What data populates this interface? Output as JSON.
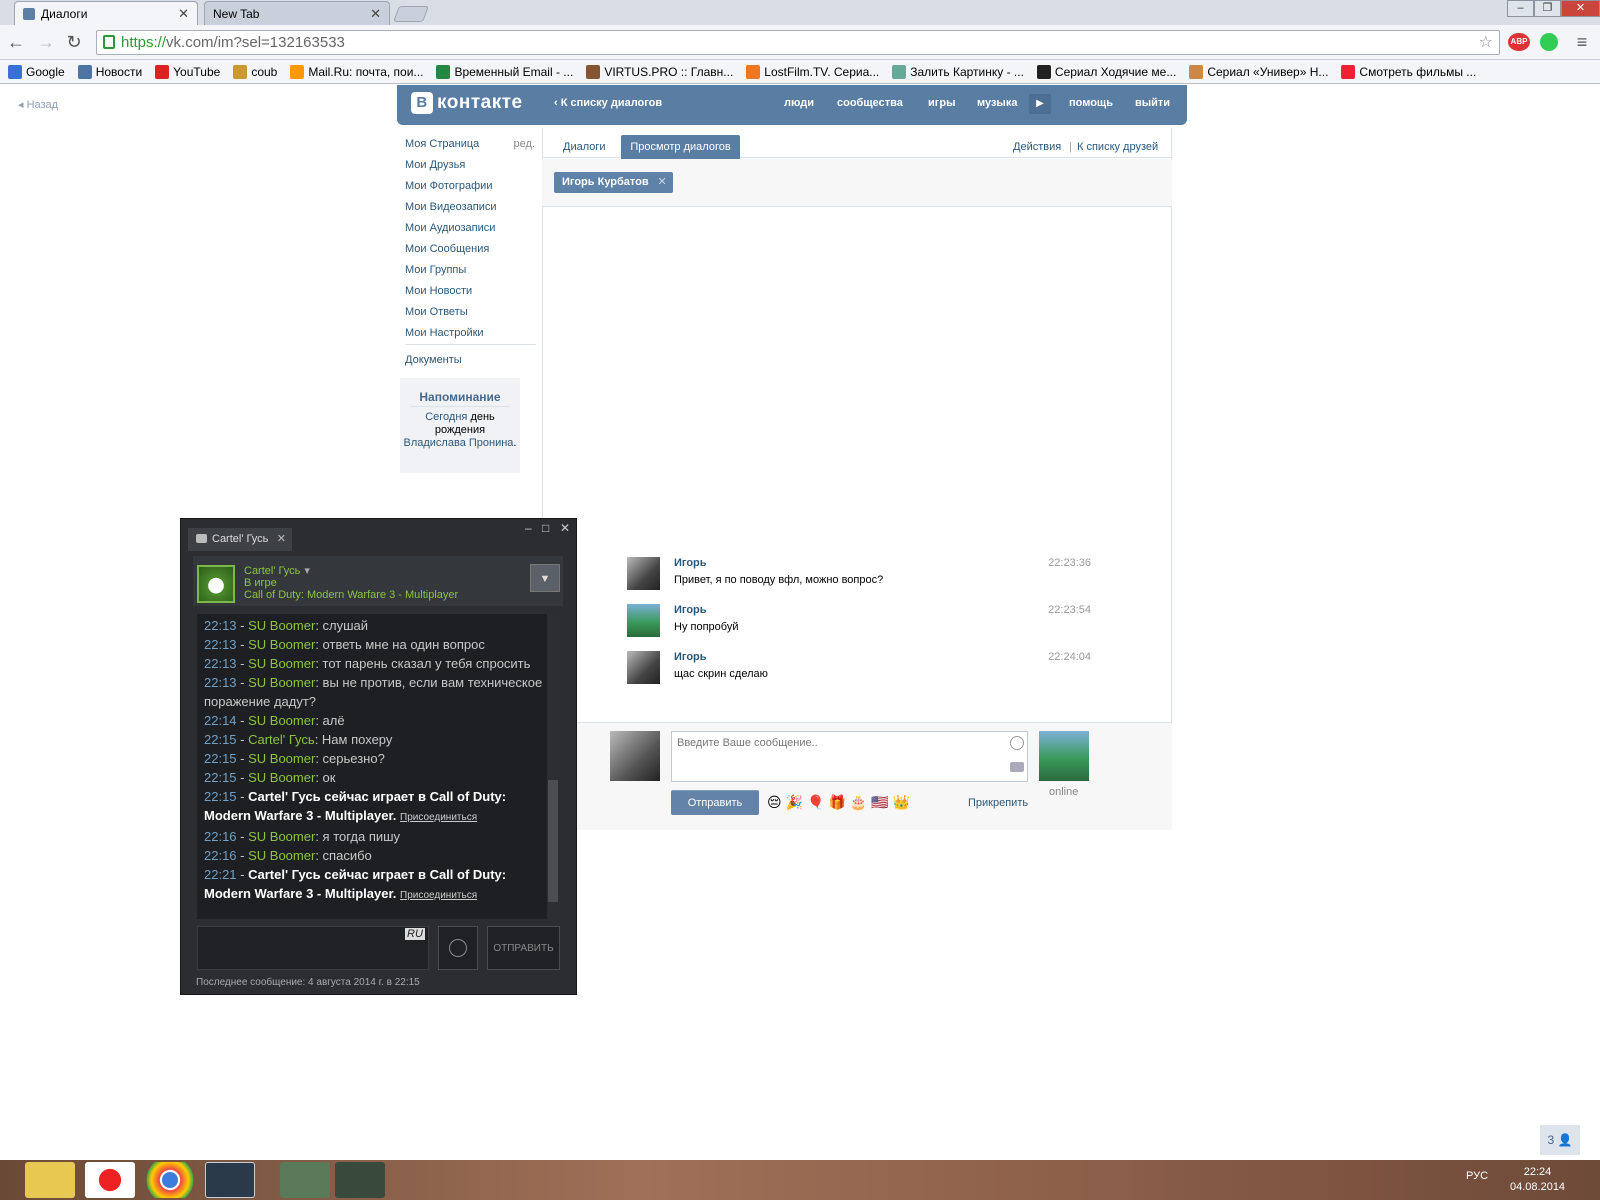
{
  "browser": {
    "tabs": [
      "Диалоги",
      "New Tab"
    ],
    "url_https": "https://",
    "url_rest": "vk.com/im?sel=132163533",
    "bookmarks": [
      "Google",
      "Новости",
      "YouTube",
      "coub",
      "Mail.Ru: почта, пои...",
      "Временный Email - ...",
      "VIRTUS.PRO :: Главн...",
      "LostFilm.TV. Сериа...",
      "Залить Картинку - ...",
      "Сериал Ходячие ме...",
      "Сериал «Универ» Н...",
      "Смотреть фильмы ..."
    ]
  },
  "vk": {
    "back": "Назад",
    "logo": "контакте",
    "back_to_list": "К списку диалогов",
    "nav": [
      "люди",
      "сообщества",
      "игры",
      "музыка",
      "помощь",
      "выйти"
    ],
    "menu": [
      "Моя Страница",
      "Мои Друзья",
      "Мои Фотографии",
      "Мои Видеозаписи",
      "Мои Аудиозаписи",
      "Мои Сообщения",
      "Мои Группы",
      "Мои Новости",
      "Мои Ответы",
      "Мои Настройки"
    ],
    "menu_edit": "ред.",
    "documents": "Документы",
    "reminder_title": "Напоминание",
    "reminder_1": "Сегодня",
    "reminder_2": "день рождения",
    "reminder_3": "Владислава Пронина",
    "reminder_dot": ".",
    "tab_dialogs": "Диалоги",
    "tab_view": "Просмотр диалогов",
    "actions": "Действия",
    "separator": "|",
    "to_friends": "К списку друзей",
    "chip": "Игорь Курбатов",
    "chip_close": "✕",
    "messages": [
      {
        "name": "Игорь",
        "text": "Привет, я по поводу вфл, можно вопрос?",
        "time": "22:23:36"
      },
      {
        "name": "Игорь",
        "text": "Ну попробуй",
        "time": "22:23:54"
      },
      {
        "name": "Игорь",
        "text": "щас скрин сделаю",
        "time": "22:24:04"
      }
    ],
    "placeholder": "Введите Ваше сообщение..",
    "online": "online",
    "send": "Отправить",
    "emojis": "😔🎉🎈🎁🎂🇺🇸👑",
    "attach": "Прикрепить"
  },
  "steam": {
    "tab": "Cartel' Гусь",
    "name": "Cartel' Гусь",
    "status": "В игре",
    "game": "Call of Duty: Modern Warfare 3 - Multiplayer",
    "log": [
      {
        "t": "22:13",
        "u": "SU Boomer",
        "m": "слушай"
      },
      {
        "t": "22:13",
        "u": "SU Boomer",
        "m": "ответь мне на один вопрос"
      },
      {
        "t": "22:13",
        "u": "SU Boomer",
        "m": "тот парень сказал у тебя спросить"
      },
      {
        "t": "22:13",
        "u": "SU Boomer",
        "m": "вы не против, если вам техническое поражение дадут?"
      },
      {
        "t": "22:14",
        "u": "SU Boomer",
        "m": "алё"
      },
      {
        "t": "22:15",
        "u": "Cartel' Гусь",
        "m": "Нам похеру"
      },
      {
        "t": "22:15",
        "u": "SU Boomer",
        "m": "серьезно?"
      },
      {
        "t": "22:15",
        "u": "SU Boomer",
        "m": "ок"
      },
      {
        "t": "22:15",
        "u": "",
        "m": "Cartel' Гусь сейчас играет в Call of Duty: Modern Warfare 3 - Multiplayer.",
        "join": "Присоединиться"
      },
      {
        "t": "22:16",
        "u": "SU Boomer",
        "m": "я тогда пишу"
      },
      {
        "t": "22:16",
        "u": "SU Boomer",
        "m": "спасибо"
      },
      {
        "t": "22:21",
        "u": "",
        "m": "Cartel' Гусь сейчас играет в Call of Duty: Modern Warfare 3 - Multiplayer.",
        "join": "Присоединиться"
      }
    ],
    "lang": "RU",
    "send": "ОТПРАВИТЬ",
    "last": "Последнее сообщение: 4 августа 2014 г. в 22:15"
  },
  "counter": "3 👤",
  "tray_lang": "РУС",
  "clock_time": "22:24",
  "clock_date": "04.08.2014",
  "icons": [
    "vk-icon",
    "search-icon",
    "star-icon",
    "smile-icon",
    "camera-icon",
    "steam-chat-icon",
    "explorer-icon",
    "yandex-icon",
    "chrome-icon",
    "steam-icon"
  ]
}
